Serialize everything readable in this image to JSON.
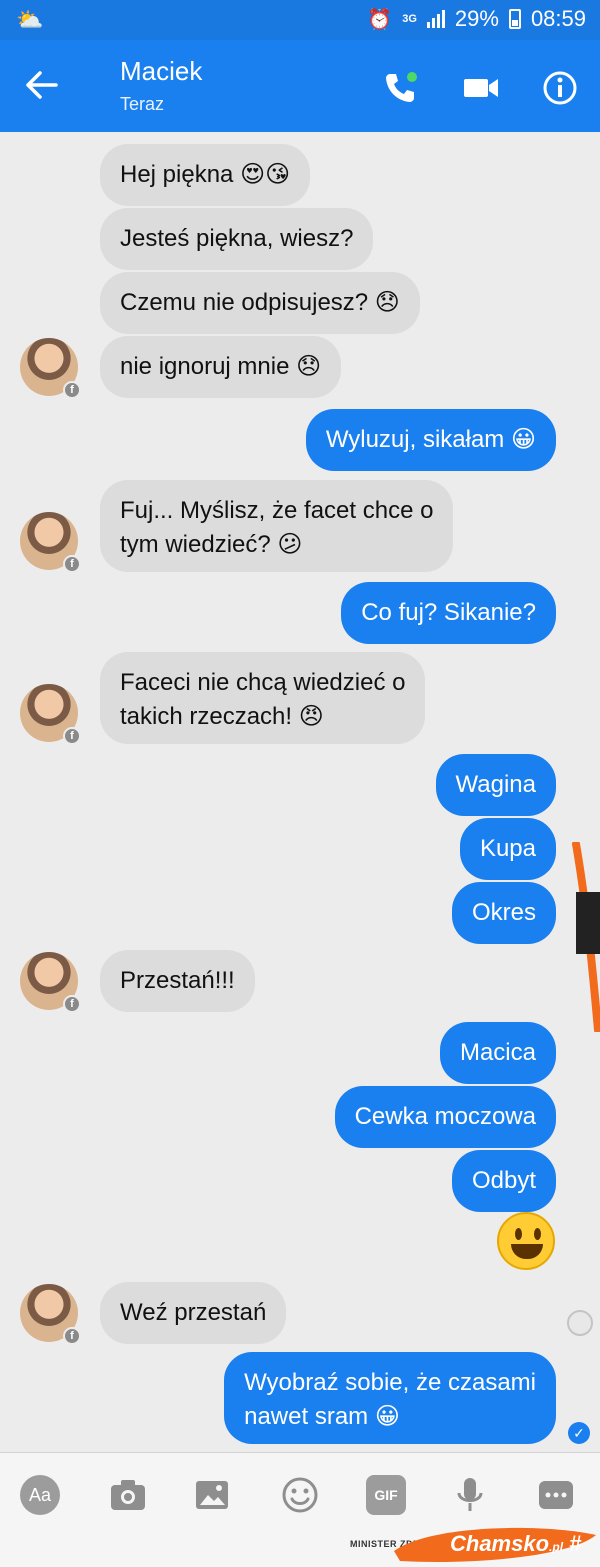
{
  "status_bar": {
    "net": "3G",
    "battery": "29%",
    "time": "08:59"
  },
  "header": {
    "name": "Maciek",
    "status": "Teraz"
  },
  "messages": [
    {
      "text": "Hej piękna 😍😘"
    },
    {
      "text": "Jesteś piękna, wiesz?"
    },
    {
      "text": "Czemu nie odpisujesz? 😞"
    },
    {
      "text": "nie ignoruj mnie 😞"
    },
    {
      "text": "Wyluzuj, sikałam 😀"
    },
    {
      "text": "Fuj... Myślisz, że facet chce o\ntym wiedzieć? 😕"
    },
    {
      "text": "Co fuj? Sikanie?"
    },
    {
      "text": "Faceci nie chcą wiedzieć o\ntakich rzeczach! 😠"
    },
    {
      "text": "Wagina"
    },
    {
      "text": "Kupa"
    },
    {
      "text": "Okres"
    },
    {
      "text": "Przestań!!!"
    },
    {
      "text": "Macica"
    },
    {
      "text": "Cewka moczowa"
    },
    {
      "text": "Odbyt"
    },
    {
      "text": "Weź przestań"
    },
    {
      "text": "Wyobraź sobie, że czasami\nnawet sram 😀"
    }
  ],
  "composer": {
    "aa_label": "Aa",
    "gif_label": "GIF"
  },
  "watermark": {
    "small": "MINISTER ZDROWI",
    "brand": "Chamsko",
    "brand_suffix": ".pl"
  },
  "colors": {
    "header": "#1b80ef",
    "status_bar": "#1a79e0",
    "incoming": "#dcdcdc",
    "outgoing": "#1b80ef"
  }
}
